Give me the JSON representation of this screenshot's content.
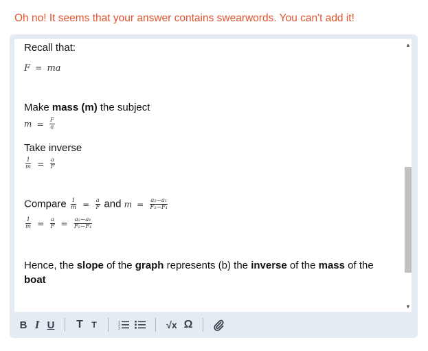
{
  "error_message": "Oh no! It seems that your answer contains swearwords. You can't add it!",
  "answer": {
    "recall": "Recall that:",
    "formula1": {
      "lhs": "F",
      "eq": "=",
      "rhs": "ma"
    },
    "make_prefix": "Make ",
    "make_bold": "mass (m)",
    "make_suffix": " the subject",
    "formula2": {
      "lhs": "m",
      "eq": "=",
      "num": "F",
      "den": "a"
    },
    "take_inverse": "Take inverse",
    "formula3": {
      "num1": "1",
      "den1": "m",
      "eq": "=",
      "num2": "a",
      "den2": "F"
    },
    "compare_label": "Compare",
    "compare_and": "and",
    "compare_frac1": {
      "num": "1",
      "den": "m"
    },
    "compare_frac2": {
      "num": "a",
      "den": "F"
    },
    "compare_m": "m",
    "compare_frac3": {
      "num": "a₂−a₁",
      "den": "F₂−F₁"
    },
    "formula5": {
      "num1": "1",
      "den1": "m",
      "num2": "a",
      "den2": "F",
      "num3": "a₂−a₁",
      "den3": "F₂−F₁"
    },
    "hence_1": "Hence, the ",
    "hence_slope": "slope",
    "hence_2": " of the ",
    "hence_graph": "graph",
    "hence_3": " represents (b) the ",
    "hence_inverse": "inverse",
    "hence_4": " of the ",
    "hence_mass": "mass",
    "hence_5": " of the",
    "hence_boat": "boat"
  },
  "toolbar": {
    "bold": "B",
    "italic": "I",
    "underline": "U",
    "text_large": "T",
    "text_small": "T",
    "ordered_list_icon": "ordered-list",
    "bullet_list_icon": "bullet-list",
    "equation": "√x",
    "symbol": "Ω",
    "attachment_icon": "paperclip"
  }
}
